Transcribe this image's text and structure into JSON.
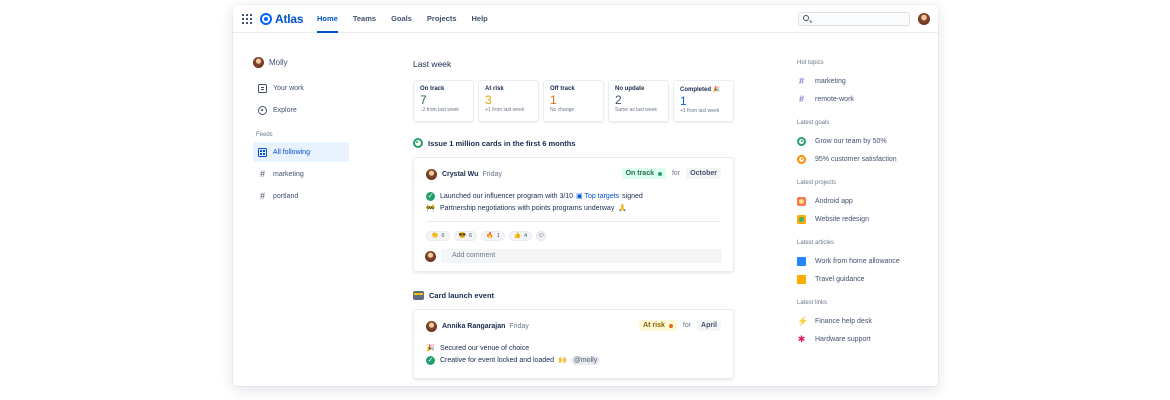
{
  "app": {
    "name": "Atlas"
  },
  "nav": {
    "tabs": [
      {
        "label": "Home",
        "active": true
      },
      {
        "label": "Teams"
      },
      {
        "label": "Goals"
      },
      {
        "label": "Projects"
      },
      {
        "label": "Help"
      }
    ],
    "search": {
      "placeholder": ""
    }
  },
  "sidebar": {
    "user": "Molly",
    "items": [
      {
        "label": "Your work",
        "icon": "work-icon"
      },
      {
        "label": "Explore",
        "icon": "compass-icon"
      }
    ],
    "feeds_label": "Feeds",
    "feeds": [
      {
        "label": "All following",
        "active": true,
        "icon": "feed-icon"
      },
      {
        "label": "marketing",
        "icon": "hash-icon"
      },
      {
        "label": "portland",
        "icon": "hash-icon"
      }
    ]
  },
  "main": {
    "section_title": "Last week",
    "stats": [
      {
        "label": "On track",
        "value": "7",
        "sub": "↓2 from last week",
        "color": "#216E4E"
      },
      {
        "label": "At risk",
        "value": "3",
        "sub": "+1 from last week",
        "color": "#E0A400"
      },
      {
        "label": "Off track",
        "value": "1",
        "sub": "No change",
        "color": "#E56910"
      },
      {
        "label": "No update",
        "value": "2",
        "sub": "Same as last week",
        "color": "#42526E"
      },
      {
        "label": "Completed 🎉",
        "value": "1",
        "sub": "+1 from last week",
        "color": "#0C66E4"
      }
    ],
    "goal": {
      "title": "Issue 1 million cards in the first 6 months",
      "update": {
        "author": "Crystal Wu",
        "when": "Friday",
        "status": "On track",
        "for_label": "for",
        "month": "October",
        "line1_pre": "Launched our influencer program with 3/10",
        "line1_link": "Top targets",
        "line1_post": "signed",
        "line2": "Partnership negotiations with points programs underway",
        "reactions": [
          {
            "emoji": "👏",
            "count": "6"
          },
          {
            "emoji": "😎",
            "count": "6"
          },
          {
            "emoji": "🔥",
            "count": "1"
          },
          {
            "emoji": "👍",
            "count": "4"
          }
        ],
        "comment_placeholder": "Add comment"
      }
    },
    "project": {
      "title": "Card launch event",
      "update": {
        "author": "Annika Rangarajan",
        "when": "Friday",
        "status": "At risk",
        "for_label": "for",
        "month": "April",
        "line1": "Secured our venue of choice",
        "line2": "Creative for event locked and loaded",
        "mention": "@molly"
      }
    }
  },
  "right": {
    "hot_topics": {
      "title": "Hot topics",
      "items": [
        "marketing",
        "remote-work"
      ]
    },
    "latest_goals": {
      "title": "Latest goals",
      "items": [
        "Grow our team by 50%",
        "95% customer satisfaction"
      ]
    },
    "latest_projects": {
      "title": "Latest projects",
      "items": [
        "Android app",
        "Website redesign"
      ]
    },
    "latest_articles": {
      "title": "Latest articles",
      "items": [
        "Work from home allowance",
        "Travel guidance"
      ]
    },
    "latest_links": {
      "title": "Latest links",
      "items": [
        "Finance help desk",
        "Hardware support"
      ]
    }
  }
}
